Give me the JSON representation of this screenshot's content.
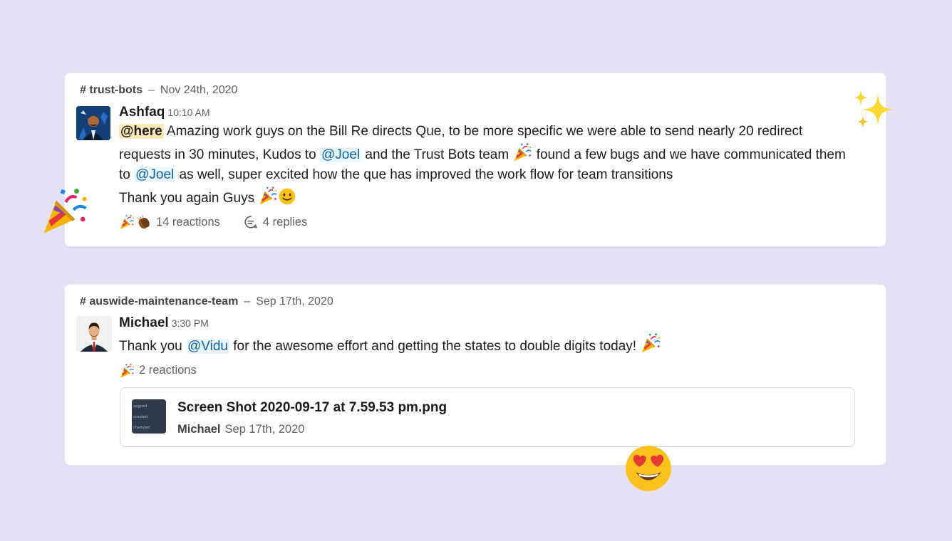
{
  "messages": [
    {
      "channel": "# trust-bots",
      "separator": "–",
      "date": "Nov 24th, 2020",
      "author": "Ashfaq",
      "time": "10:10 AM",
      "body": {
        "here": "@here",
        "t1": " Amazing work guys on the Bill Re directs Que, to be more specific we were able to send nearly 20 redirect requests in 30 minutes, Kudos to ",
        "mention1": "@Joel",
        "t2": " and the Trust Bots team ",
        "t3": " found a few bugs and we have communicated them to ",
        "mention2": "@Joel",
        "t4": " as well, super excited how the que has improved the work flow for team transitions",
        "line2": "Thank you again Guys "
      },
      "reactions_label": "14 reactions",
      "replies_label": "4 replies"
    },
    {
      "channel": "# auswide-maintenance-team",
      "separator": "–",
      "date": "Sep 17th, 2020",
      "author": "Michael",
      "time": "3:30 PM",
      "body": {
        "t1": "Thank you ",
        "mention1": "@Vidu",
        "t2": " for the awesome effort and getting the states to double digits today! "
      },
      "reactions_label": "2 reactions",
      "attachment": {
        "filename": "Screen Shot 2020-09-17 at 7.59.53 pm.png",
        "uploader": "Michael",
        "date": "Sep 17th, 2020",
        "thumb_lines": [
          "ssigned",
          "ccepted",
          "cheduled"
        ]
      }
    }
  ],
  "icons": {
    "party": "party-popper-icon",
    "clap": "clapping-hands-icon",
    "smile": "smiling-face-icon",
    "replies": "speech-bubble-icon",
    "sparkles": "sparkles-icon",
    "heart_eyes": "heart-eyes-face-icon"
  },
  "colors": {
    "background": "#e4e1f4",
    "mention": "#1264a3",
    "mention_bg": "#e8f5fa",
    "here_bg": "#f8e9b6"
  }
}
